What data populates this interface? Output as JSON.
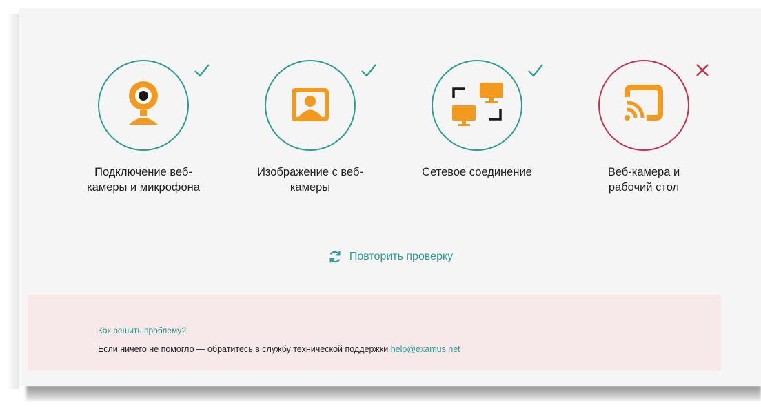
{
  "checks": [
    {
      "label_line1": "Подключение веб-",
      "label_line2": "камеры и микрофона",
      "status": "success",
      "icon": "webcam-icon"
    },
    {
      "label_line1": "Изображение с веб-",
      "label_line2": "камеры",
      "status": "success",
      "icon": "user-portrait-icon"
    },
    {
      "label_line1": "Сетевое соединение",
      "label_line2": "",
      "status": "success",
      "icon": "network-computers-icon"
    },
    {
      "label_line1": "Веб-камера и",
      "label_line2": "рабочий стол",
      "status": "failure",
      "icon": "screen-cast-icon"
    }
  ],
  "retry": {
    "label": "Повторить проверку",
    "icon": "refresh-icon"
  },
  "help": {
    "title": "Как решить проблему?",
    "text": "Если ничего не помогло — обратитесь в службу технической поддержки",
    "email": "help@examus.net"
  },
  "colors": {
    "accent": "#2a9d92",
    "error": "#c4314b",
    "icon_orange": "#f39a1e",
    "help_bg": "#f7e8ea"
  }
}
